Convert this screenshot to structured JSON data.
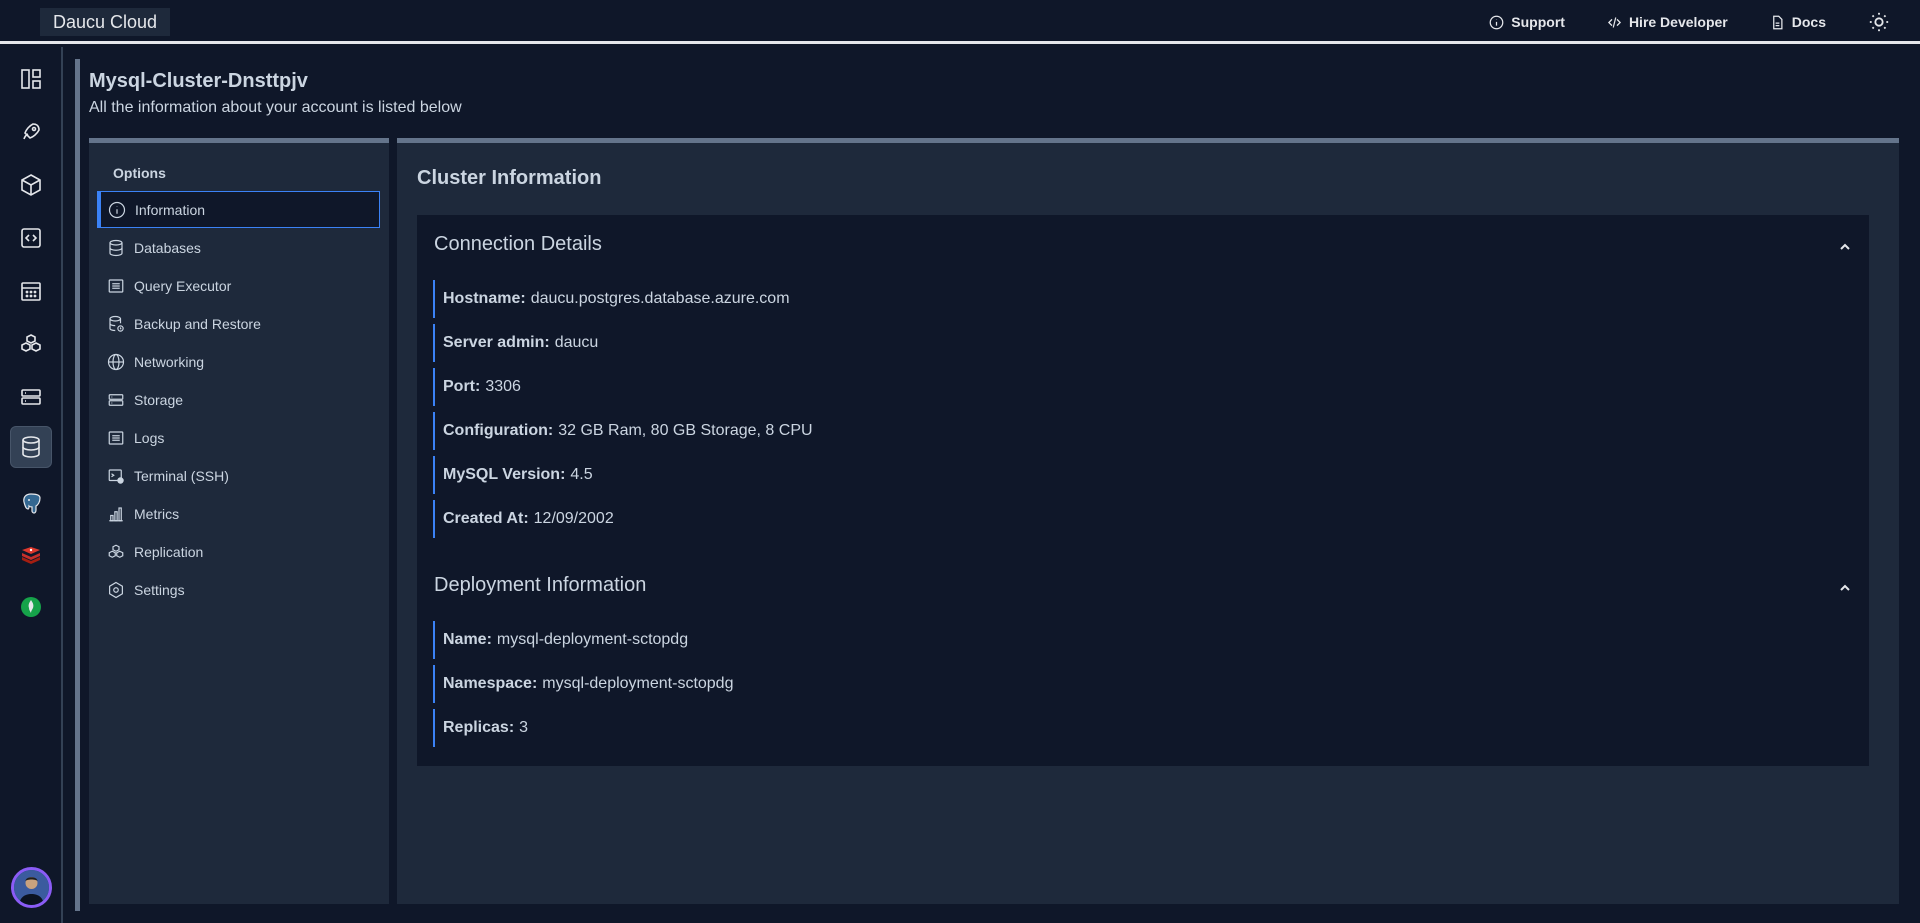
{
  "app": {
    "name": "Daucu Cloud"
  },
  "topnav": {
    "support": "Support",
    "hire": "Hire Developer",
    "docs": "Docs"
  },
  "page": {
    "title": "Mysql-Cluster-Dnsttpjv",
    "subtitle": "All the information about your account is listed below"
  },
  "options": {
    "title": "Options",
    "items": [
      {
        "label": "Information",
        "icon": "info-icon"
      },
      {
        "label": "Databases",
        "icon": "database-icon"
      },
      {
        "label": "Query Executor",
        "icon": "list-icon"
      },
      {
        "label": "Backup and Restore",
        "icon": "database-backup-icon"
      },
      {
        "label": "Networking",
        "icon": "globe-icon"
      },
      {
        "label": "Storage",
        "icon": "server-icon"
      },
      {
        "label": "Logs",
        "icon": "list-icon"
      },
      {
        "label": "Terminal (SSH)",
        "icon": "terminal-icon"
      },
      {
        "label": "Metrics",
        "icon": "bar-chart-icon"
      },
      {
        "label": "Replication",
        "icon": "boxes-icon"
      },
      {
        "label": "Settings",
        "icon": "settings-icon"
      }
    ]
  },
  "content": {
    "title": "Cluster Information",
    "connection": {
      "heading": "Connection Details",
      "fields": [
        {
          "label": "Hostname:",
          "value": "daucu.postgres.database.azure.com"
        },
        {
          "label": "Server admin:",
          "value": "daucu"
        },
        {
          "label": "Port:",
          "value": "3306"
        },
        {
          "label": "Configuration:",
          "value": "32 GB Ram, 80 GB Storage, 8 CPU"
        },
        {
          "label": "MySQL Version:",
          "value": "4.5"
        },
        {
          "label": "Created At:",
          "value": "12/09/2002"
        }
      ]
    },
    "deployment": {
      "heading": "Deployment Information",
      "fields": [
        {
          "label": "Name:",
          "value": "mysql-deployment-sctopdg"
        },
        {
          "label": "Namespace:",
          "value": "mysql-deployment-sctopdg"
        },
        {
          "label": "Replicas:",
          "value": "3"
        }
      ]
    }
  },
  "colors": {
    "accent": "#3b82f6",
    "background": "#0f1729",
    "panel": "#1e293b"
  }
}
